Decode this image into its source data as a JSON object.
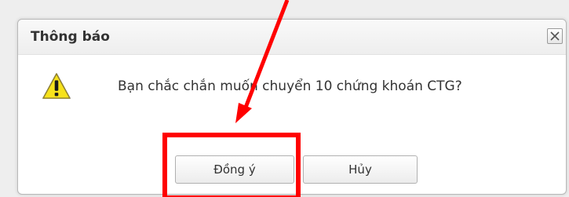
{
  "dialog": {
    "title": "Thông báo",
    "message": "Bạn chắc chắn muốn chuyển 10 chứng khoán CTG?",
    "ok_label": "Đồng ý",
    "cancel_label": "Hủy"
  },
  "annotation": {
    "color": "#ff0000"
  },
  "icons": {
    "close": "close-icon",
    "warning": "warning-icon"
  }
}
